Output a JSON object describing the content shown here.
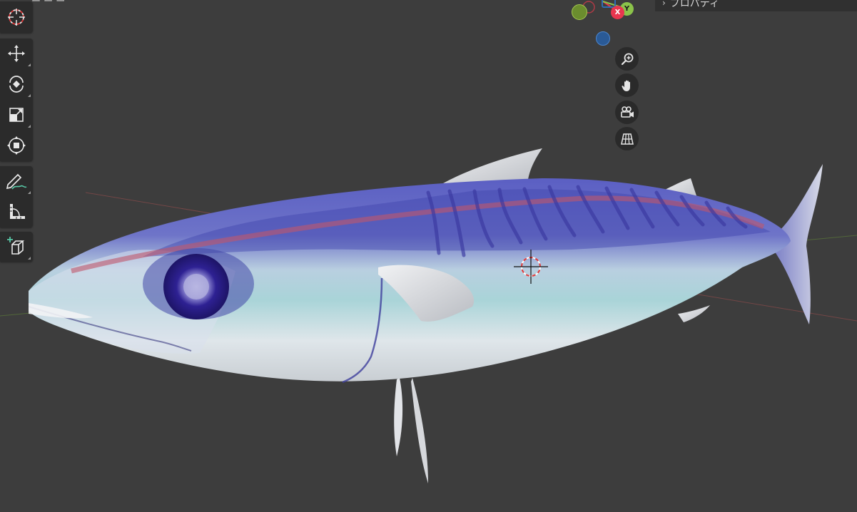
{
  "viewport": {
    "header_partial_text": "ー ー ー",
    "background_color": "#3d3d3d"
  },
  "properties_panel": {
    "chevron": "›",
    "label": "プロパティ"
  },
  "toolbar": {
    "tools": [
      {
        "name": "cursor-tool",
        "icon": "cursor-icon"
      },
      {
        "name": "move-tool",
        "icon": "move-icon"
      },
      {
        "name": "rotate-tool",
        "icon": "rotate-icon"
      },
      {
        "name": "scale-tool",
        "icon": "scale-icon"
      },
      {
        "name": "transform-tool",
        "icon": "transform-icon"
      },
      {
        "name": "annotate-tool",
        "icon": "annotate-icon"
      },
      {
        "name": "measure-tool",
        "icon": "measure-icon"
      },
      {
        "name": "add-cube-tool",
        "icon": "add-cube-icon"
      }
    ]
  },
  "gizmo": {
    "x_label": "X",
    "y_label": "Y",
    "x_color": "#e8364f",
    "y_color": "#8bc34a",
    "z_color": "#2f6db5"
  },
  "navigation": {
    "buttons": [
      {
        "name": "zoom-button",
        "icon": "zoom-icon"
      },
      {
        "name": "pan-button",
        "icon": "hand-icon"
      },
      {
        "name": "camera-button",
        "icon": "camera-icon"
      },
      {
        "name": "ortho-toggle-button",
        "icon": "grid-icon"
      }
    ]
  },
  "scene": {
    "object": "fish-model",
    "colors": {
      "body_light": "#e6e9ee",
      "belly_tint": "#9fd0d4",
      "back_blue": "#4a4fb3",
      "stripe_red": "#c0566a",
      "eye": "#2b1e8a"
    }
  }
}
